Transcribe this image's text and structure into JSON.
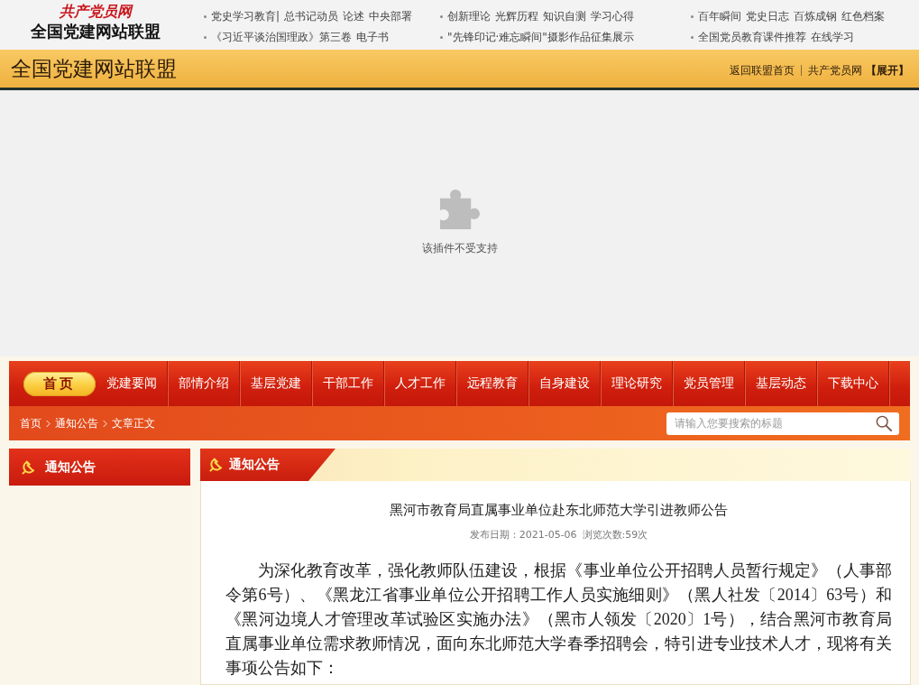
{
  "header": {
    "logo": {
      "brush_text": "共产党员网",
      "title": "全国党建网站联盟"
    },
    "link_columns": [
      {
        "lines": [
          [
            "党史学习教育|",
            "总书记动员",
            "论述",
            "中央部署"
          ],
          [
            "《习近平谈治国理政》第三卷",
            "电子书"
          ]
        ]
      },
      {
        "lines": [
          [
            "创新理论",
            "光辉历程",
            "知识自测",
            "学习心得"
          ],
          [
            "\"先锋印记·难忘瞬间\"摄影作品征集展示"
          ]
        ]
      },
      {
        "lines": [
          [
            "百年瞬间",
            "党史日志",
            "百炼成钢",
            "红色档案"
          ],
          [
            "全国党员教育课件推荐",
            "在线学习"
          ]
        ]
      }
    ]
  },
  "banner": {
    "title": "全国党建网站联盟",
    "links": [
      "返回联盟首页",
      "共产党员网"
    ],
    "expand": "【展开】"
  },
  "plugin": {
    "message": "该插件不受支持"
  },
  "nav": [
    {
      "label": "首页",
      "selected": true
    },
    {
      "label": "党建要闻",
      "selected": false
    },
    {
      "label": "部情介绍",
      "selected": false
    },
    {
      "label": "基层党建",
      "selected": false
    },
    {
      "label": "干部工作",
      "selected": false
    },
    {
      "label": "人才工作",
      "selected": false
    },
    {
      "label": "远程教育",
      "selected": false
    },
    {
      "label": "自身建设",
      "selected": false
    },
    {
      "label": "理论研究",
      "selected": false
    },
    {
      "label": "党员管理",
      "selected": false
    },
    {
      "label": "基层动态",
      "selected": false
    },
    {
      "label": "下载中心",
      "selected": false
    }
  ],
  "breadcrumb": [
    "首页",
    "通知公告",
    "文章正文"
  ],
  "search": {
    "placeholder": "请输入您要搜索的标题"
  },
  "sidebar": {
    "title": "通知公告"
  },
  "article": {
    "section": "通知公告",
    "title": "黑河市教育局直属事业单位赴东北师范大学引进教师公告",
    "date": "发布日期：2021-05-06",
    "views": "浏览次数:59次",
    "body": "为深化教育改革，强化教师队伍建设，根据《事业单位公开招聘人员暂行规定》（人事部令第6号）、《黑龙江省事业单位公开招聘工作人员实施细则》（黑人社发〔2014〕63号）和《黑河边境人才管理改革试验区实施办法》（黑市人领发〔2020〕1号），结合黑河市教育局直属事业单位需求教师情况，面向东北师范大学春季招聘会，特引进专业技术人才，现将有关事项公告如下："
  }
}
